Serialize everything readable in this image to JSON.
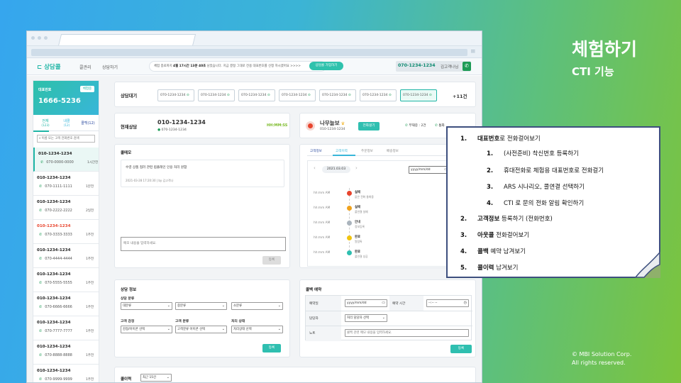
{
  "slide": {
    "title": "체험하기",
    "subtitle": "CTI 기능",
    "copyright_line1": "© MBI Solution Corp.",
    "copyright_line2": "All rights reserved."
  },
  "nav": {
    "logo": "⊏ 상담콜",
    "links": [
      "콜관리",
      "상담하기"
    ],
    "notice_prefix": "체험 종료까지 ",
    "notice_bold": "4월 17시간 13분 40초",
    "notice_suffix": " 남았습니다. 지금 결정 그대로 전용 대표번호를 신청 하시겠어요 >>>>",
    "cta": "상담콜 가입하기",
    "phone": "070-1234-1234",
    "user": "김고객나님"
  },
  "sidebar": {
    "label": "대표번호",
    "main_number": "1666-5236",
    "callback_btn": "체험중",
    "tabs": [
      {
        "label": "전체",
        "count": "(123)"
      },
      {
        "label": "내콜",
        "count": "(12)"
      },
      {
        "label": "콜백(12)",
        "count": ""
      }
    ],
    "search_placeholder": "이름 또는 고객 전화번호 검색",
    "items": [
      {
        "name": "010-1234-1234",
        "phone": "070-0000-0000",
        "time": "1시간전"
      },
      {
        "name": "010-1234-1234",
        "phone": "070-1111-1111",
        "time": "1분전"
      },
      {
        "name": "010-1234-1234",
        "phone": "070-2222-2222",
        "time": "2일전"
      },
      {
        "name": "010-1234-1234",
        "phone": "070-3333-3333",
        "time": "1주전"
      },
      {
        "name": "010-1234-1234",
        "phone": "070-4444-4444",
        "time": "1주전"
      },
      {
        "name": "010-1234-1234",
        "phone": "070-5555-5555",
        "time": "1주전"
      },
      {
        "name": "010-1234-1234",
        "phone": "070-6666-6666",
        "time": "1주전"
      },
      {
        "name": "010-1234-1234",
        "phone": "070-7777-7777",
        "time": "1주전"
      },
      {
        "name": "010-1234-1234",
        "phone": "070-8888-8888",
        "time": "1주전"
      },
      {
        "name": "010-1234-1234",
        "phone": "070-9999-9999",
        "time": "1주전"
      }
    ]
  },
  "waiting": {
    "title": "상담대기",
    "chips": [
      "070-1234-1234",
      "070-1234-1234",
      "070-1234-1234",
      "070-1234-1234",
      "070-1234-1234",
      "070-1234-1234",
      "070-1234-1234"
    ],
    "more": "+11건"
  },
  "current": {
    "title": "현재상담",
    "number": "010-1234-1234",
    "sub": "070-1234-1234",
    "timer": "HH:MM:SS"
  },
  "customer": {
    "name": "나무늘보",
    "number": "010-1234-1234",
    "transfer_btn": "전화걸기",
    "absent": "부재중 : 2건",
    "calls": "통화"
  },
  "memo": {
    "title": "콜메모",
    "note_text": "수령 상품 접러 관련 컴플레인 인용 처리 원함",
    "note_meta": "2021-03-28 17:20:30 | by 김고객나",
    "input_placeholder": "메모 내용을 입력하세요.",
    "save_btn": "등록"
  },
  "detail_tabs": [
    "고객정보",
    "고객이력",
    "주문정보",
    "배송정보"
  ],
  "history": {
    "date": "2021.03.03",
    "date_input": "yyyy/mm/dd",
    "entries": [
      {
        "time": "hh:mm AM",
        "title": "실패",
        "desc": "없은 전화 통화중"
      },
      {
        "time": "hh:mm AM",
        "title": "실패",
        "desc": "콜연결 실패"
      },
      {
        "time": "hh:mm AM",
        "title": "안내",
        "desc": "정보등록"
      },
      {
        "time": "hh:mm AM",
        "title": "완료",
        "desc": "알림톡"
      },
      {
        "time": "hh:mm AM",
        "title": "완료",
        "desc": "콜연결 성공"
      }
    ]
  },
  "consult": {
    "title": "상담 정보",
    "category": "상담 분류",
    "cat_opts": [
      "대분류",
      "중분류",
      "소분류"
    ],
    "emotion": "고객 감정",
    "emotion_val": "감정/아이콘 선택",
    "type": "고객 분류",
    "type_val": "고객분류 아이콘 선택",
    "status": "처리 상태",
    "status_val": "처리상태 선택",
    "save_btn": "등록"
  },
  "callback": {
    "title": "콜백 예약",
    "date_label": "예약일",
    "date_ph": "yyyy/mm/dd",
    "time_label": "예약 시간",
    "time_ph": "--:-- --",
    "agent_label": "담당자",
    "agent_val": "처리 담당자 선택",
    "note_label": "노트",
    "note_ph": "콜백 관련 메모 내용을 입력하세요.",
    "save_btn": "등록"
  },
  "history_list": {
    "title": "콜이력",
    "filter": "최근 15건"
  },
  "callout": {
    "items": [
      {
        "num": "1.",
        "bold": "대표번호",
        "rest": "로 전화걸어보기",
        "level": 1
      },
      {
        "num": "1.",
        "bold": "",
        "rest": "(사전준비) 착신번호 등록하기",
        "level": 2
      },
      {
        "num": "2.",
        "bold": "",
        "rest": "휴대전화로 체험용 대표번호로 전화걸기",
        "level": 2
      },
      {
        "num": "3.",
        "bold": "",
        "rest": "ARS 시나리오, 콜연결 선택하기",
        "level": 2
      },
      {
        "num": "4.",
        "bold": "",
        "rest": "CTI 로 문의 전화 알림 확인하기",
        "level": 2
      },
      {
        "num": "2.",
        "bold": "고객정보",
        "rest": " 등록하기 (전화번호)",
        "level": 1
      },
      {
        "num": "3.",
        "bold": "아웃콜",
        "rest": " 전화걸어보기",
        "level": 1
      },
      {
        "num": "4.",
        "bold": "콜백",
        "rest": "  예약 남겨보기",
        "level": 1
      },
      {
        "num": "5.",
        "bold": "콜이력",
        "rest": " 남겨보기",
        "level": 1
      }
    ]
  },
  "colors": {
    "accent": "#1fb5a5",
    "call_green": "#1d9b56",
    "alert": "#e8442d",
    "callout_border": "#3d4f7e"
  }
}
